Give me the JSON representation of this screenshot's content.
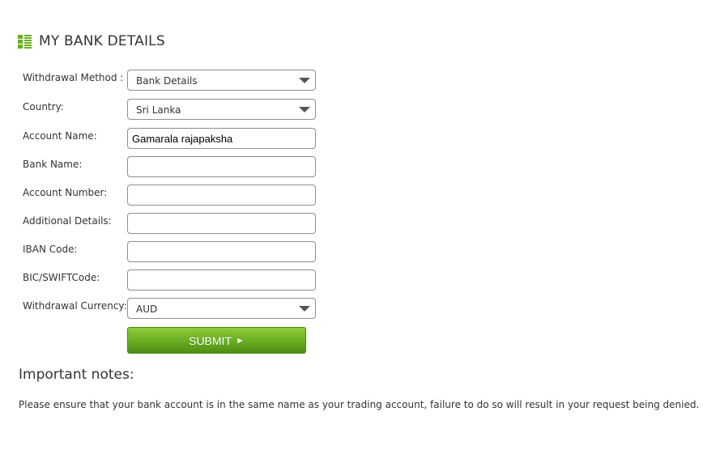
{
  "header": {
    "icon": "grid-list-icon",
    "title": "MY BANK DETAILS"
  },
  "colors": {
    "accent": "#6ab023",
    "button_top": "#8fcc3a",
    "button_bottom": "#4f8c14"
  },
  "form": {
    "withdrawal_method": {
      "label": "Withdrawal Method :",
      "value": "Bank Details"
    },
    "country": {
      "label": "Country:",
      "value": "Sri Lanka"
    },
    "account_name": {
      "label": "Account Name:",
      "value": "Gamarala rajapaksha"
    },
    "bank_name": {
      "label": "Bank Name:",
      "value": ""
    },
    "account_number": {
      "label": "Account Number:",
      "value": ""
    },
    "additional_details": {
      "label": "Additional Details:",
      "value": ""
    },
    "iban_code": {
      "label": "IBAN Code:",
      "value": ""
    },
    "bic_swift": {
      "label": "BIC/SWIFTCode:",
      "value": ""
    },
    "withdrawal_currency": {
      "label": "Withdrawal Currency:",
      "value": "AUD"
    },
    "submit": {
      "label": "SUBMIT",
      "icon": "play-icon",
      "icon_glyph": "►"
    }
  },
  "notes": {
    "heading": "Important notes:",
    "text": "Please ensure that your bank account is in the same name as your trading account, failure to do so will result in your request being denied."
  }
}
